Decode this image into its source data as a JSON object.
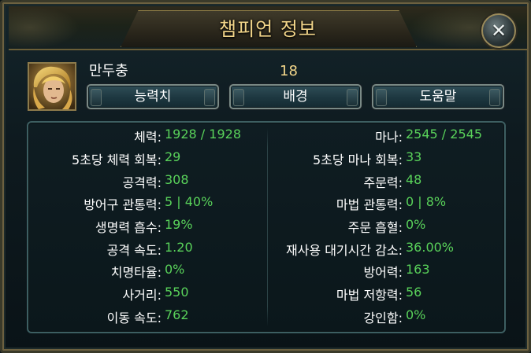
{
  "window": {
    "title": "챔피언 정보",
    "close_symbol": "✕"
  },
  "champion": {
    "name": "만두충",
    "level": "18",
    "portrait_icon": "champion-portrait"
  },
  "tabs": [
    {
      "label": "능력치"
    },
    {
      "label": "배경"
    },
    {
      "label": "도움말"
    }
  ],
  "stats_left": [
    {
      "label": "체력:",
      "value": "1928 / 1928"
    },
    {
      "label": "5초당 체력 회복:",
      "value": "29"
    },
    {
      "label": "공격력:",
      "value": "308"
    },
    {
      "label": "방어구 관통력:",
      "value": "5 | 40%"
    },
    {
      "label": "생명력 흡수:",
      "value": "19%"
    },
    {
      "label": "공격 속도:",
      "value": "1.20"
    },
    {
      "label": "치명타율:",
      "value": "0%"
    },
    {
      "label": "사거리:",
      "value": "550"
    },
    {
      "label": "이동 속도:",
      "value": "762"
    }
  ],
  "stats_right": [
    {
      "label": "마나:",
      "value": "2545 / 2545"
    },
    {
      "label": "5초당 마나 회복:",
      "value": "33"
    },
    {
      "label": "주문력:",
      "value": "48"
    },
    {
      "label": "마법 관통력:",
      "value": "0 | 8%"
    },
    {
      "label": "주문 흡혈:",
      "value": "0%"
    },
    {
      "label": "재사용 대기시간 감소:",
      "value": "36.00%"
    },
    {
      "label": "방어력:",
      "value": "163"
    },
    {
      "label": "마법 저항력:",
      "value": "56"
    },
    {
      "label": "강인함:",
      "value": "0%"
    }
  ],
  "colors": {
    "title": "#f3d68a",
    "stat_value": "#59d25a",
    "stat_label": "#ffffff"
  }
}
